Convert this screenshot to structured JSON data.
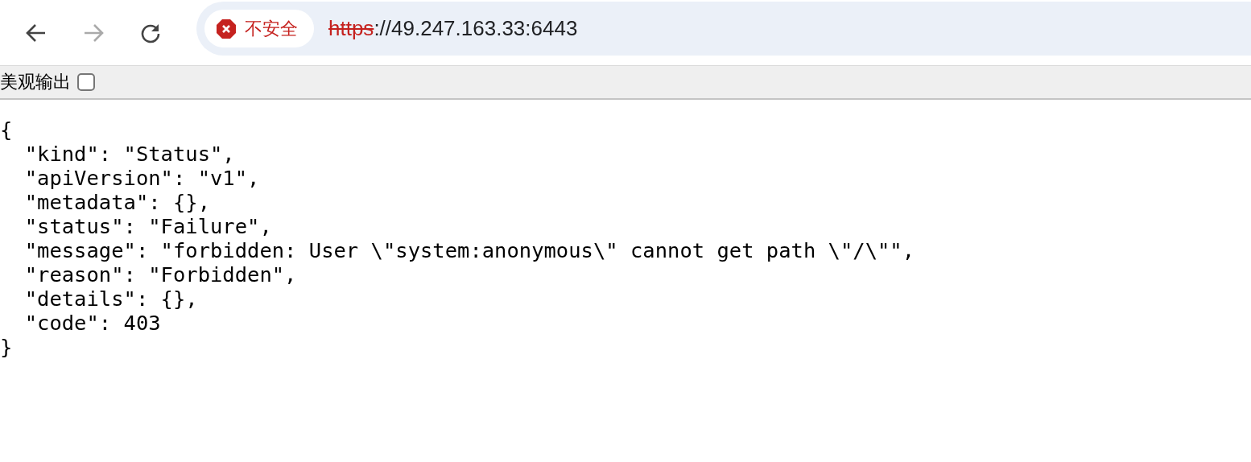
{
  "toolbar": {
    "security_chip": {
      "label": "不安全"
    },
    "address": {
      "scheme": "https",
      "rest": "://49.247.163.33:6443"
    }
  },
  "pretty_print": {
    "label": "美观输出",
    "checked": false
  },
  "code_lines": [
    "{",
    "  \"kind\": \"Status\",",
    "  \"apiVersion\": \"v1\",",
    "  \"metadata\": {},",
    "  \"status\": \"Failure\",",
    "  \"message\": \"forbidden: User \\\"system:anonymous\\\" cannot get path \\\"/\\\"\",",
    "  \"reason\": \"Forbidden\",",
    "  \"details\": {},",
    "  \"code\": 403",
    "}"
  ]
}
